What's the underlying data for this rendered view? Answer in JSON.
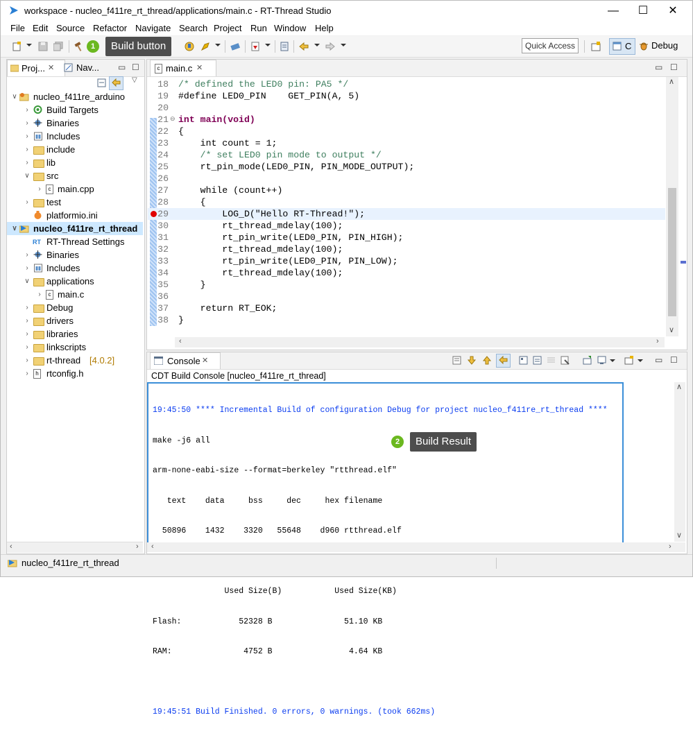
{
  "window": {
    "title": "workspace - nucleo_f411re_rt_thread/applications/main.c - RT-Thread Studio",
    "minimize": "—",
    "maximize": "☐",
    "close": "✕"
  },
  "menu": [
    "File",
    "Edit",
    "Source",
    "Refactor",
    "Navigate",
    "Search",
    "Project",
    "Run",
    "Window",
    "Help"
  ],
  "toolbar": {
    "quick_access": "Quick Access",
    "perspective_c": "C",
    "perspective_debug": "Debug"
  },
  "callouts": {
    "build": {
      "num": "1",
      "text": "Build button"
    },
    "result": {
      "num": "2",
      "text": "Build Result"
    }
  },
  "left_panel": {
    "tabs": [
      {
        "label": "Proj..."
      },
      {
        "label": "Nav..."
      }
    ],
    "tree": [
      {
        "label": "nucleo_f411re_arduino",
        "suffix": ""
      },
      {
        "label": "Build Targets",
        "suffix": ""
      },
      {
        "label": "Binaries",
        "suffix": ""
      },
      {
        "label": "Includes",
        "suffix": ""
      },
      {
        "label": "include",
        "suffix": ""
      },
      {
        "label": "lib",
        "suffix": ""
      },
      {
        "label": "src",
        "suffix": ""
      },
      {
        "label": "main.cpp",
        "suffix": ""
      },
      {
        "label": "test",
        "suffix": ""
      },
      {
        "label": "platformio.ini",
        "suffix": ""
      },
      {
        "label": "nucleo_f411re_rt_thread",
        "suffix": ""
      },
      {
        "label": "RT-Thread Settings",
        "suffix": ""
      },
      {
        "label": "Binaries",
        "suffix": ""
      },
      {
        "label": "Includes",
        "suffix": ""
      },
      {
        "label": "applications",
        "suffix": ""
      },
      {
        "label": "main.c",
        "suffix": ""
      },
      {
        "label": "Debug",
        "suffix": ""
      },
      {
        "label": "drivers",
        "suffix": ""
      },
      {
        "label": "libraries",
        "suffix": ""
      },
      {
        "label": "linkscripts",
        "suffix": ""
      },
      {
        "label": "rt-thread",
        "suffix": "[4.0.2]"
      },
      {
        "label": "rtconfig.h",
        "suffix": ""
      }
    ]
  },
  "editor": {
    "tab": "main.c",
    "lines": [
      {
        "n": "18",
        "t": "/* defined the LED0 pin: PA5 */"
      },
      {
        "n": "19",
        "t": "#define LED0_PIN    GET_PIN(A, 5)"
      },
      {
        "n": "20",
        "t": ""
      },
      {
        "n": "21",
        "t": "int main(void)"
      },
      {
        "n": "22",
        "t": "{"
      },
      {
        "n": "23",
        "t": "    int count = 1;"
      },
      {
        "n": "24",
        "t": "    /* set LED0 pin mode to output */"
      },
      {
        "n": "25",
        "t": "    rt_pin_mode(LED0_PIN, PIN_MODE_OUTPUT);"
      },
      {
        "n": "26",
        "t": ""
      },
      {
        "n": "27",
        "t": "    while (count++)"
      },
      {
        "n": "28",
        "t": "    {"
      },
      {
        "n": "29",
        "t": "        LOG_D(\"Hello RT-Thread!\");"
      },
      {
        "n": "30",
        "t": "        rt_thread_mdelay(100);"
      },
      {
        "n": "31",
        "t": "        rt_pin_write(LED0_PIN, PIN_HIGH);"
      },
      {
        "n": "32",
        "t": "        rt_thread_mdelay(100);"
      },
      {
        "n": "33",
        "t": "        rt_pin_write(LED0_PIN, PIN_LOW);"
      },
      {
        "n": "34",
        "t": "        rt_thread_mdelay(100);"
      },
      {
        "n": "35",
        "t": "    }"
      },
      {
        "n": "36",
        "t": ""
      },
      {
        "n": "37",
        "t": "    return RT_EOK;"
      },
      {
        "n": "38",
        "t": "}"
      }
    ]
  },
  "console": {
    "tab": "Console",
    "title": "CDT Build Console [nucleo_f411re_rt_thread]",
    "lines": [
      {
        "t": "19:45:50 **** Incremental Build of configuration Debug for project nucleo_f411re_rt_thread ****",
        "blue": true
      },
      {
        "t": "make -j6 all",
        "blue": false
      },
      {
        "t": "arm-none-eabi-size --format=berkeley \"rtthread.elf\"",
        "blue": false
      },
      {
        "t": "   text    data     bss     dec     hex filename",
        "blue": false
      },
      {
        "t": "  50896    1432    3320   55648    d960 rtthread.elf",
        "blue": false
      },
      {
        "t": "",
        "blue": false
      },
      {
        "t": "               Used Size(B)           Used Size(KB)",
        "blue": false
      },
      {
        "t": "Flash:            52328 B               51.10 KB",
        "blue": false
      },
      {
        "t": "RAM:               4752 B                4.64 KB",
        "blue": false
      },
      {
        "t": "",
        "blue": false
      },
      {
        "t": "19:45:51 Build Finished. 0 errors, 0 warnings. (took 662ms)",
        "blue": true
      }
    ]
  },
  "status_bar": {
    "text": "nucleo_f411re_rt_thread"
  },
  "colors": {
    "callout_bg": "#4d4d4d",
    "callout_num": "#6bb81f",
    "highlight_box": "#3b8ed8",
    "keyword": "#7f0055",
    "comment": "#3f7f5f",
    "string": "#2a00ff",
    "console_blue": "#0a3cf0"
  }
}
